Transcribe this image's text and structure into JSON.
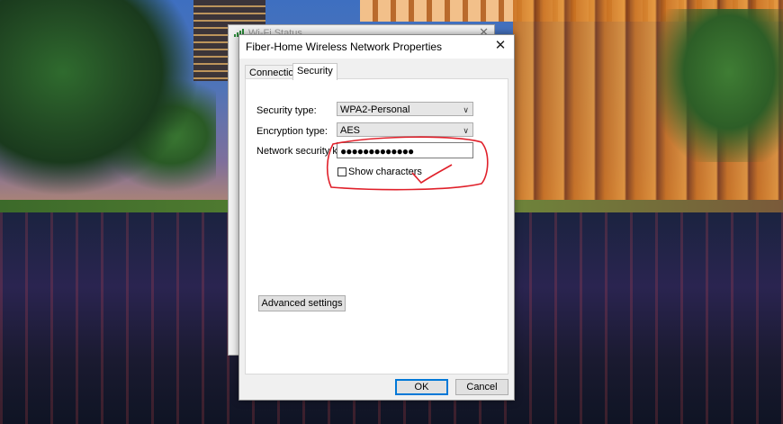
{
  "background_window": {
    "title": "Wi-Fi Status",
    "close_glyph": "✕"
  },
  "dialog": {
    "title": "Fiber-Home Wireless Network Properties",
    "close_glyph": "✕",
    "tabs": [
      {
        "label": "Connection",
        "selected": false
      },
      {
        "label": "Security",
        "selected": true
      }
    ],
    "security": {
      "security_type_label": "Security type:",
      "security_type_value": "WPA2-Personal",
      "encryption_type_label": "Encryption type:",
      "encryption_type_value": "AES",
      "network_key_label": "Network security key",
      "network_key_value": "●●●●●●●●●●●●●",
      "show_characters_label": "Show characters",
      "show_characters_checked": false,
      "advanced_settings_label": "Advanced settings"
    },
    "buttons": {
      "ok": "OK",
      "cancel": "Cancel"
    }
  },
  "colors": {
    "annotation_red": "#e0202a",
    "default_button_border": "#0078d7",
    "wifi_signal_green": "#2d8c3a"
  },
  "icons": {
    "dropdown": "chevron-down-icon",
    "wifi": "wifi-signal-icon"
  }
}
